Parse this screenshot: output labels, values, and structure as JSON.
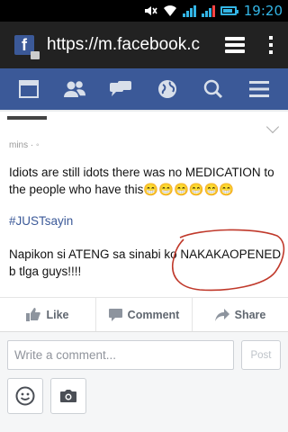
{
  "status_bar": {
    "time": "19:20"
  },
  "browser": {
    "url": "https://m.facebook.c"
  },
  "nav": {
    "items": [
      "news-feed",
      "friends",
      "messages",
      "notifications",
      "search",
      "menu"
    ]
  },
  "post": {
    "meta": "mins · ",
    "text1": "Idiots are still idots there was no MEDICATION to the people who have this😁😁😁😁😁😁",
    "hashtag": "#JUSTsayin",
    "text2": "Napikon si ATENG sa sinabi ko NAKAKAOPENED b tlga guys!!!!"
  },
  "actions": {
    "like": "Like",
    "comment": "Comment",
    "share": "Share"
  },
  "composer": {
    "placeholder": "Write a comment...",
    "post_label": "Post"
  },
  "colors": {
    "fb_blue": "#3b5998",
    "status_accent": "#33b5e5",
    "annotation_red": "#c0392b"
  }
}
